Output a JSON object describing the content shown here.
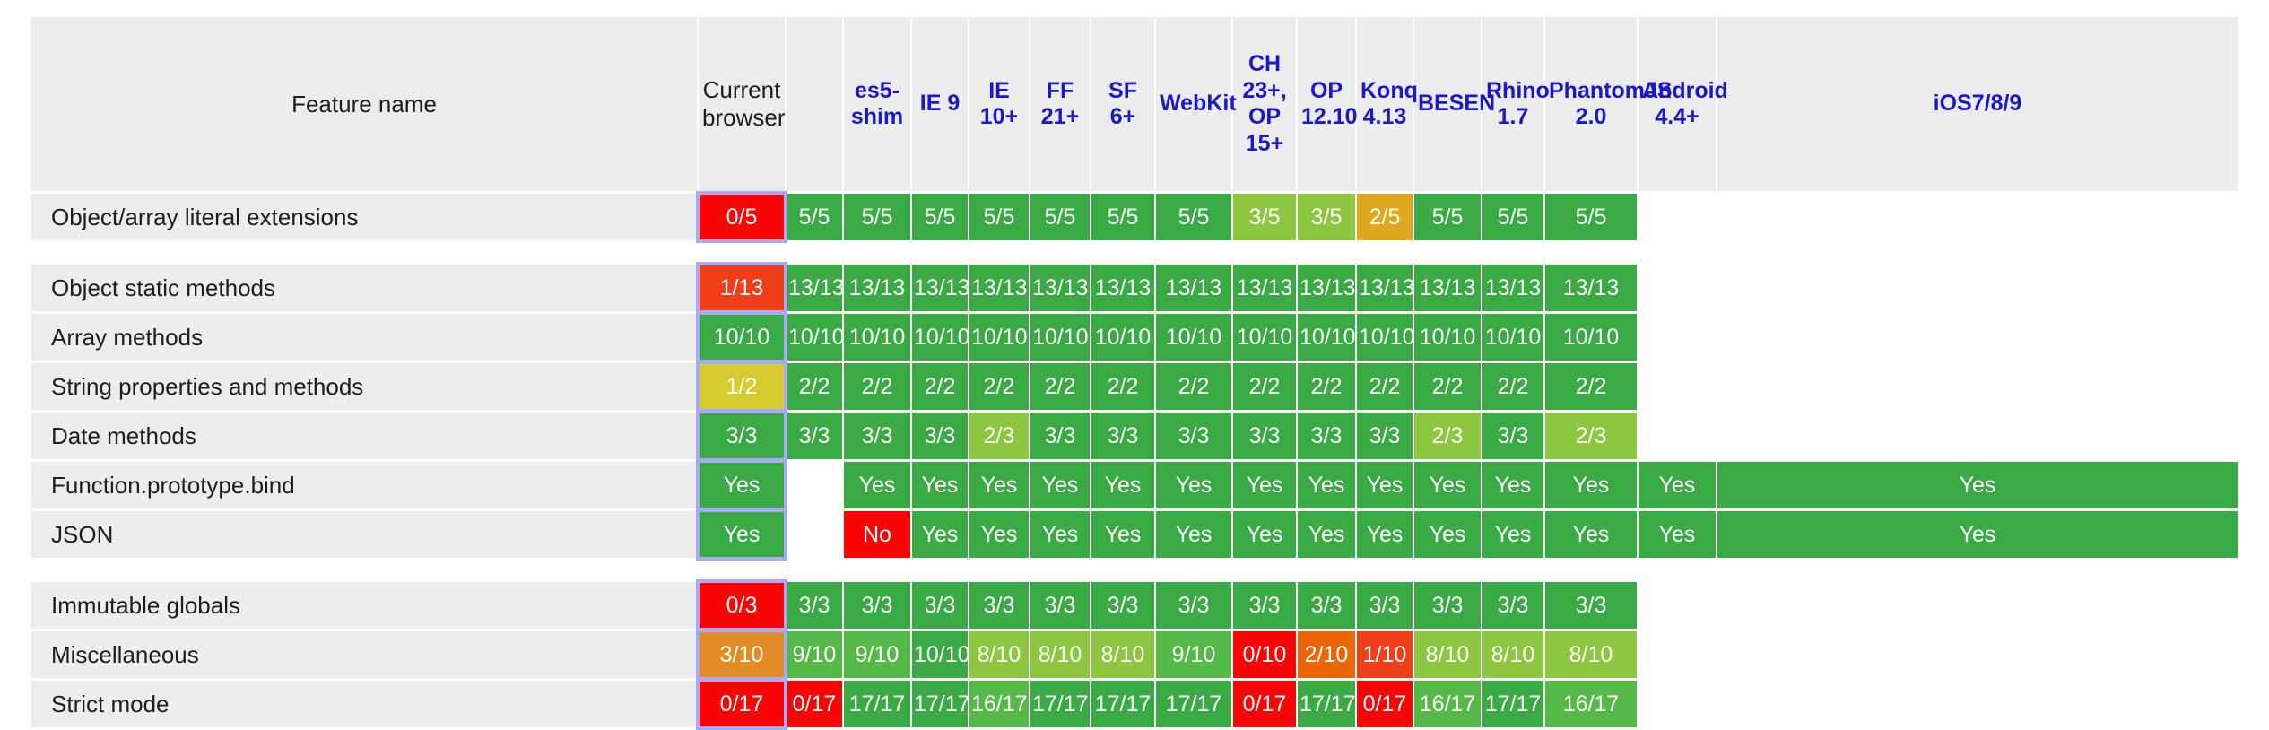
{
  "table": {
    "feature_column_header": "Feature name",
    "columns": [
      {
        "key": "current",
        "label": "Current browser",
        "highlight": true
      },
      {
        "key": "blank",
        "label": "",
        "highlight": false
      },
      {
        "key": "es5shim",
        "label": "es5-shim",
        "highlight": false
      },
      {
        "key": "ie9",
        "label": "IE 9",
        "highlight": false
      },
      {
        "key": "ie10",
        "label": "IE 10+",
        "highlight": false
      },
      {
        "key": "ff21",
        "label": "FF 21+",
        "highlight": false
      },
      {
        "key": "sf6",
        "label": "SF 6+",
        "highlight": false
      },
      {
        "key": "webkit",
        "label": "WebKit",
        "highlight": false
      },
      {
        "key": "ch23",
        "label": "CH 23+, OP 15+",
        "highlight": false
      },
      {
        "key": "op1210",
        "label": "OP 12.10",
        "highlight": false
      },
      {
        "key": "konq",
        "label": "Konq 4.13",
        "highlight": false
      },
      {
        "key": "besen",
        "label": "BESEN",
        "highlight": false
      },
      {
        "key": "rhino",
        "label": "Rhino 1.7",
        "highlight": false
      },
      {
        "key": "phantom",
        "label": "PhantomJS 2.0",
        "highlight": false
      },
      {
        "key": "android",
        "label": "Android 4.4+",
        "highlight": false
      },
      {
        "key": "ios",
        "label": "iOS7/8/9",
        "highlight": false
      }
    ],
    "rows": [
      {
        "feature": "Object/array literal extensions",
        "cells": [
          {
            "text": "0/5",
            "color": "c-red"
          },
          {
            "text": "5/5",
            "color": "c-green"
          },
          {
            "text": "5/5",
            "color": "c-green"
          },
          {
            "text": "5/5",
            "color": "c-green"
          },
          {
            "text": "5/5",
            "color": "c-green"
          },
          {
            "text": "5/5",
            "color": "c-green"
          },
          {
            "text": "5/5",
            "color": "c-green"
          },
          {
            "text": "5/5",
            "color": "c-green"
          },
          {
            "text": "3/5",
            "color": "c-yg"
          },
          {
            "text": "3/5",
            "color": "c-yg"
          },
          {
            "text": "2/5",
            "color": "c-gold"
          },
          {
            "text": "5/5",
            "color": "c-green"
          },
          {
            "text": "5/5",
            "color": "c-green"
          },
          {
            "text": "5/5",
            "color": "c-green"
          },
          {
            "text": "",
            "color": "empty"
          },
          {
            "text": "",
            "color": "empty"
          }
        ]
      },
      {
        "spacer": true
      },
      {
        "feature": "Object static methods",
        "cells": [
          {
            "text": "1/13",
            "color": "c-redor"
          },
          {
            "text": "13/13",
            "color": "c-green"
          },
          {
            "text": "13/13",
            "color": "c-green"
          },
          {
            "text": "13/13",
            "color": "c-green"
          },
          {
            "text": "13/13",
            "color": "c-green"
          },
          {
            "text": "13/13",
            "color": "c-green"
          },
          {
            "text": "13/13",
            "color": "c-green"
          },
          {
            "text": "13/13",
            "color": "c-green"
          },
          {
            "text": "13/13",
            "color": "c-green"
          },
          {
            "text": "13/13",
            "color": "c-green"
          },
          {
            "text": "13/13",
            "color": "c-green"
          },
          {
            "text": "13/13",
            "color": "c-green"
          },
          {
            "text": "13/13",
            "color": "c-green"
          },
          {
            "text": "13/13",
            "color": "c-green"
          },
          {
            "text": "",
            "color": "empty"
          },
          {
            "text": "",
            "color": "empty"
          }
        ]
      },
      {
        "feature": "Array methods",
        "cells": [
          {
            "text": "10/10",
            "color": "c-green"
          },
          {
            "text": "10/10",
            "color": "c-green"
          },
          {
            "text": "10/10",
            "color": "c-green"
          },
          {
            "text": "10/10",
            "color": "c-green"
          },
          {
            "text": "10/10",
            "color": "c-green"
          },
          {
            "text": "10/10",
            "color": "c-green"
          },
          {
            "text": "10/10",
            "color": "c-green"
          },
          {
            "text": "10/10",
            "color": "c-green"
          },
          {
            "text": "10/10",
            "color": "c-green"
          },
          {
            "text": "10/10",
            "color": "c-green"
          },
          {
            "text": "10/10",
            "color": "c-green"
          },
          {
            "text": "10/10",
            "color": "c-green"
          },
          {
            "text": "10/10",
            "color": "c-green"
          },
          {
            "text": "10/10",
            "color": "c-green"
          },
          {
            "text": "",
            "color": "empty"
          },
          {
            "text": "",
            "color": "empty"
          }
        ]
      },
      {
        "feature": "String properties and methods",
        "cells": [
          {
            "text": "1/2",
            "color": "c-yellow"
          },
          {
            "text": "2/2",
            "color": "c-green"
          },
          {
            "text": "2/2",
            "color": "c-green"
          },
          {
            "text": "2/2",
            "color": "c-green"
          },
          {
            "text": "2/2",
            "color": "c-green"
          },
          {
            "text": "2/2",
            "color": "c-green"
          },
          {
            "text": "2/2",
            "color": "c-green"
          },
          {
            "text": "2/2",
            "color": "c-green"
          },
          {
            "text": "2/2",
            "color": "c-green"
          },
          {
            "text": "2/2",
            "color": "c-green"
          },
          {
            "text": "2/2",
            "color": "c-green"
          },
          {
            "text": "2/2",
            "color": "c-green"
          },
          {
            "text": "2/2",
            "color": "c-green"
          },
          {
            "text": "2/2",
            "color": "c-green"
          },
          {
            "text": "",
            "color": "empty"
          },
          {
            "text": "",
            "color": "empty"
          }
        ]
      },
      {
        "feature": "Date methods",
        "cells": [
          {
            "text": "3/3",
            "color": "c-green"
          },
          {
            "text": "3/3",
            "color": "c-green"
          },
          {
            "text": "3/3",
            "color": "c-green"
          },
          {
            "text": "3/3",
            "color": "c-green"
          },
          {
            "text": "2/3",
            "color": "c-yg"
          },
          {
            "text": "3/3",
            "color": "c-green"
          },
          {
            "text": "3/3",
            "color": "c-green"
          },
          {
            "text": "3/3",
            "color": "c-green"
          },
          {
            "text": "3/3",
            "color": "c-green"
          },
          {
            "text": "3/3",
            "color": "c-green"
          },
          {
            "text": "3/3",
            "color": "c-green"
          },
          {
            "text": "2/3",
            "color": "c-yg"
          },
          {
            "text": "3/3",
            "color": "c-green"
          },
          {
            "text": "2/3",
            "color": "c-yg"
          },
          {
            "text": "",
            "color": "empty"
          },
          {
            "text": "",
            "color": "empty"
          }
        ]
      },
      {
        "feature": "Function.prototype.bind",
        "cells": [
          {
            "text": "Yes",
            "color": "c-green"
          },
          {
            "text": "",
            "color": "empty"
          },
          {
            "text": "Yes",
            "color": "c-green"
          },
          {
            "text": "Yes",
            "color": "c-green"
          },
          {
            "text": "Yes",
            "color": "c-green"
          },
          {
            "text": "Yes",
            "color": "c-green"
          },
          {
            "text": "Yes",
            "color": "c-green"
          },
          {
            "text": "Yes",
            "color": "c-green"
          },
          {
            "text": "Yes",
            "color": "c-green"
          },
          {
            "text": "Yes",
            "color": "c-green"
          },
          {
            "text": "Yes",
            "color": "c-green"
          },
          {
            "text": "Yes",
            "color": "c-green"
          },
          {
            "text": "Yes",
            "color": "c-green"
          },
          {
            "text": "Yes",
            "color": "c-green"
          },
          {
            "text": "Yes",
            "color": "c-green"
          },
          {
            "text": "Yes",
            "color": "c-green"
          }
        ]
      },
      {
        "feature": "JSON",
        "cells": [
          {
            "text": "Yes",
            "color": "c-green"
          },
          {
            "text": "",
            "color": "empty"
          },
          {
            "text": "No",
            "color": "c-red"
          },
          {
            "text": "Yes",
            "color": "c-green"
          },
          {
            "text": "Yes",
            "color": "c-green"
          },
          {
            "text": "Yes",
            "color": "c-green"
          },
          {
            "text": "Yes",
            "color": "c-green"
          },
          {
            "text": "Yes",
            "color": "c-green"
          },
          {
            "text": "Yes",
            "color": "c-green"
          },
          {
            "text": "Yes",
            "color": "c-green"
          },
          {
            "text": "Yes",
            "color": "c-green"
          },
          {
            "text": "Yes",
            "color": "c-green"
          },
          {
            "text": "Yes",
            "color": "c-green"
          },
          {
            "text": "Yes",
            "color": "c-green"
          },
          {
            "text": "Yes",
            "color": "c-green"
          },
          {
            "text": "Yes",
            "color": "c-green"
          }
        ]
      },
      {
        "spacer": true
      },
      {
        "feature": "Immutable globals",
        "cells": [
          {
            "text": "0/3",
            "color": "c-red"
          },
          {
            "text": "3/3",
            "color": "c-green"
          },
          {
            "text": "3/3",
            "color": "c-green"
          },
          {
            "text": "3/3",
            "color": "c-green"
          },
          {
            "text": "3/3",
            "color": "c-green"
          },
          {
            "text": "3/3",
            "color": "c-green"
          },
          {
            "text": "3/3",
            "color": "c-green"
          },
          {
            "text": "3/3",
            "color": "c-green"
          },
          {
            "text": "3/3",
            "color": "c-green"
          },
          {
            "text": "3/3",
            "color": "c-green"
          },
          {
            "text": "3/3",
            "color": "c-green"
          },
          {
            "text": "3/3",
            "color": "c-green"
          },
          {
            "text": "3/3",
            "color": "c-green"
          },
          {
            "text": "3/3",
            "color": "c-green"
          },
          {
            "text": "",
            "color": "empty"
          },
          {
            "text": "",
            "color": "empty"
          }
        ]
      },
      {
        "feature": "Miscellaneous",
        "cells": [
          {
            "text": "3/10",
            "color": "c-orange"
          },
          {
            "text": "9/10",
            "color": "c-green2"
          },
          {
            "text": "9/10",
            "color": "c-green2"
          },
          {
            "text": "10/10",
            "color": "c-green"
          },
          {
            "text": "8/10",
            "color": "c-yg"
          },
          {
            "text": "8/10",
            "color": "c-yg"
          },
          {
            "text": "8/10",
            "color": "c-yg"
          },
          {
            "text": "9/10",
            "color": "c-green2"
          },
          {
            "text": "0/10",
            "color": "c-red"
          },
          {
            "text": "2/10",
            "color": "c-orange2"
          },
          {
            "text": "1/10",
            "color": "c-redor"
          },
          {
            "text": "8/10",
            "color": "c-yg"
          },
          {
            "text": "8/10",
            "color": "c-yg"
          },
          {
            "text": "8/10",
            "color": "c-yg"
          },
          {
            "text": "",
            "color": "empty"
          },
          {
            "text": "",
            "color": "empty"
          }
        ]
      },
      {
        "feature": "Strict mode",
        "cells": [
          {
            "text": "0/17",
            "color": "c-red"
          },
          {
            "text": "0/17",
            "color": "c-red"
          },
          {
            "text": "17/17",
            "color": "c-green"
          },
          {
            "text": "17/17",
            "color": "c-green"
          },
          {
            "text": "16/17",
            "color": "c-green2"
          },
          {
            "text": "17/17",
            "color": "c-green"
          },
          {
            "text": "17/17",
            "color": "c-green"
          },
          {
            "text": "17/17",
            "color": "c-green"
          },
          {
            "text": "0/17",
            "color": "c-red"
          },
          {
            "text": "17/17",
            "color": "c-green"
          },
          {
            "text": "0/17",
            "color": "c-red"
          },
          {
            "text": "16/17",
            "color": "c-green2"
          },
          {
            "text": "17/17",
            "color": "c-green"
          },
          {
            "text": "16/17",
            "color": "c-green2"
          },
          {
            "text": "",
            "color": "empty"
          },
          {
            "text": "",
            "color": "empty"
          }
        ]
      }
    ]
  },
  "colors": {
    "header_bg": "#ececec",
    "feature_bg": "#ededed",
    "link_blue": "#1919cc",
    "highlight_outline": "#a9a9f5",
    "pass_green": "#3aaa45",
    "fail_red": "#fa0505"
  }
}
